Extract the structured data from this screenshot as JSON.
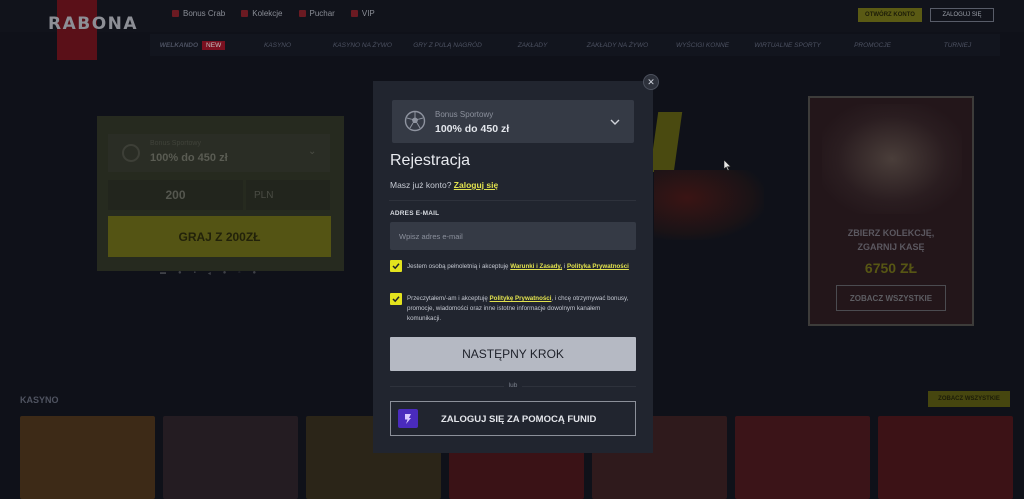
{
  "header": {
    "logo": "RABONA",
    "top_links": [
      "Bonus Crab",
      "Kolekcje",
      "Puchar",
      "VIP"
    ],
    "open_account": "OTWÓRZ KONTO",
    "login": "ZALOGUJ SIĘ"
  },
  "nav": {
    "items": [
      "WELKANDO",
      "KASYNO",
      "KASYNO NA ŻYWO",
      "GRY Z PULĄ NAGRÓD",
      "ZAKŁADY",
      "ZAKŁADY NA ŻYWO",
      "WYŚCIGI KONNE",
      "WIRTUALNE SPORTY",
      "PROMOCJE",
      "TURNIEJ"
    ],
    "new_badge": "NEW"
  },
  "amount_card": {
    "subtitle": "Bonus Sportowy",
    "bonus": "100% do 450 zł",
    "amount": "200",
    "currency": "PLN",
    "play": "GRAJ Z 200ZŁ"
  },
  "promo": {
    "line1": "ZBIERZ KOLEKCJĘ,",
    "line2": "ZGARNIJ KASĘ",
    "amount": "6750 ZŁ",
    "button": "ZOBACZ WSZYSTKIE"
  },
  "casino": {
    "title": "KASYNO",
    "see_all": "ZOBACZ WSZYSTKIE"
  },
  "modal": {
    "bonus_select": {
      "label": "Bonus Sportowy",
      "value": "100% do 450 zł"
    },
    "title": "Rejestracja",
    "have_account": "Masz już konto?",
    "login_link": "Zaloguj się",
    "email_label": "ADRES E-MAIL",
    "email_placeholder": "Wpisz adres e-mail",
    "email_value": "",
    "checkbox1": {
      "text_before": "Jestem osobą pełnoletnią i akceptuję",
      "link1": "Warunki i Zasady,",
      "and": "i",
      "link2": "Polityka Prywatności",
      "checked": true
    },
    "checkbox2": {
      "text_before": "Przeczytałem/-am i akceptuję",
      "link": "Politykę Prywatności",
      "text_after": ", i chcę otrzymywać bonusy, promocje, wiadomości oraz inne istotne informacje dowolnym kanałem komunikacji.",
      "checked": true
    },
    "next_button": "NASTĘPNY KROK",
    "or": "lub",
    "funid_button": "ZALOGUJ SIĘ ZA POMOCĄ FUNID"
  },
  "colors": {
    "accent": "#e3e31e",
    "modal_bg": "#21252f",
    "input_bg": "#353a45",
    "funid": "#4a2bbd"
  }
}
